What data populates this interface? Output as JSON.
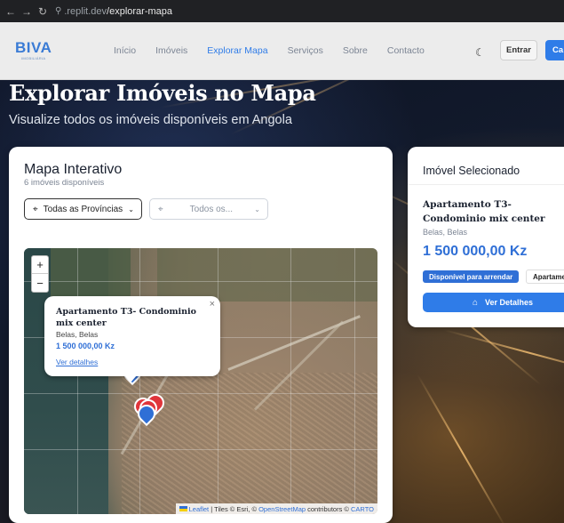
{
  "browser": {
    "back_icon": "arrow-left-icon",
    "forward_icon": "arrow-right-icon",
    "reload_icon": "reload-icon",
    "url_host": ".replit.dev",
    "url_path": "/explorar-mapa"
  },
  "header": {
    "logo_text": "BIVA",
    "logo_sub": "IMOBILIÁRIA",
    "nav": [
      "Início",
      "Imóveis",
      "Explorar Mapa",
      "Serviços",
      "Sobre",
      "Contacto"
    ],
    "active_nav": "Explorar Mapa",
    "theme_icon": "moon-icon",
    "login_label": "Entrar",
    "register_label": "Ca"
  },
  "hero": {
    "title": "Explorar Imóveis no Mapa",
    "subtitle": "Visualize todos os imóveis disponíveis em Angola"
  },
  "map_card": {
    "title": "Mapa Interativo",
    "count": "6 imóveis disponíveis",
    "province_select": "Todas as Províncias",
    "city_select": "Todos os...",
    "zoom_in": "+",
    "zoom_out": "−",
    "popup": {
      "title": "Apartamento T3- Condominio mix center",
      "location": "Belas, Belas",
      "price": "1 500 000,00 Kz",
      "link": "Ver detalhes",
      "close": "×"
    },
    "attribution": {
      "leaflet": "Leaflet",
      "tiles": " | Tiles © Esri, © ",
      "osm": "OpenStreetMap",
      "contributors": " contributors © ",
      "carto": "CARTO"
    }
  },
  "selected_card": {
    "heading": "Imóvel Selecionado",
    "title": "Apartamento T3- Condominio mix center",
    "location": "Belas, Belas",
    "price": "1 500 000,00 Kz",
    "status_badge": "Disponível para arrendar",
    "type_badge": "Apartame",
    "details_button": "Ver Detalhes",
    "home_icon": "home-icon"
  }
}
